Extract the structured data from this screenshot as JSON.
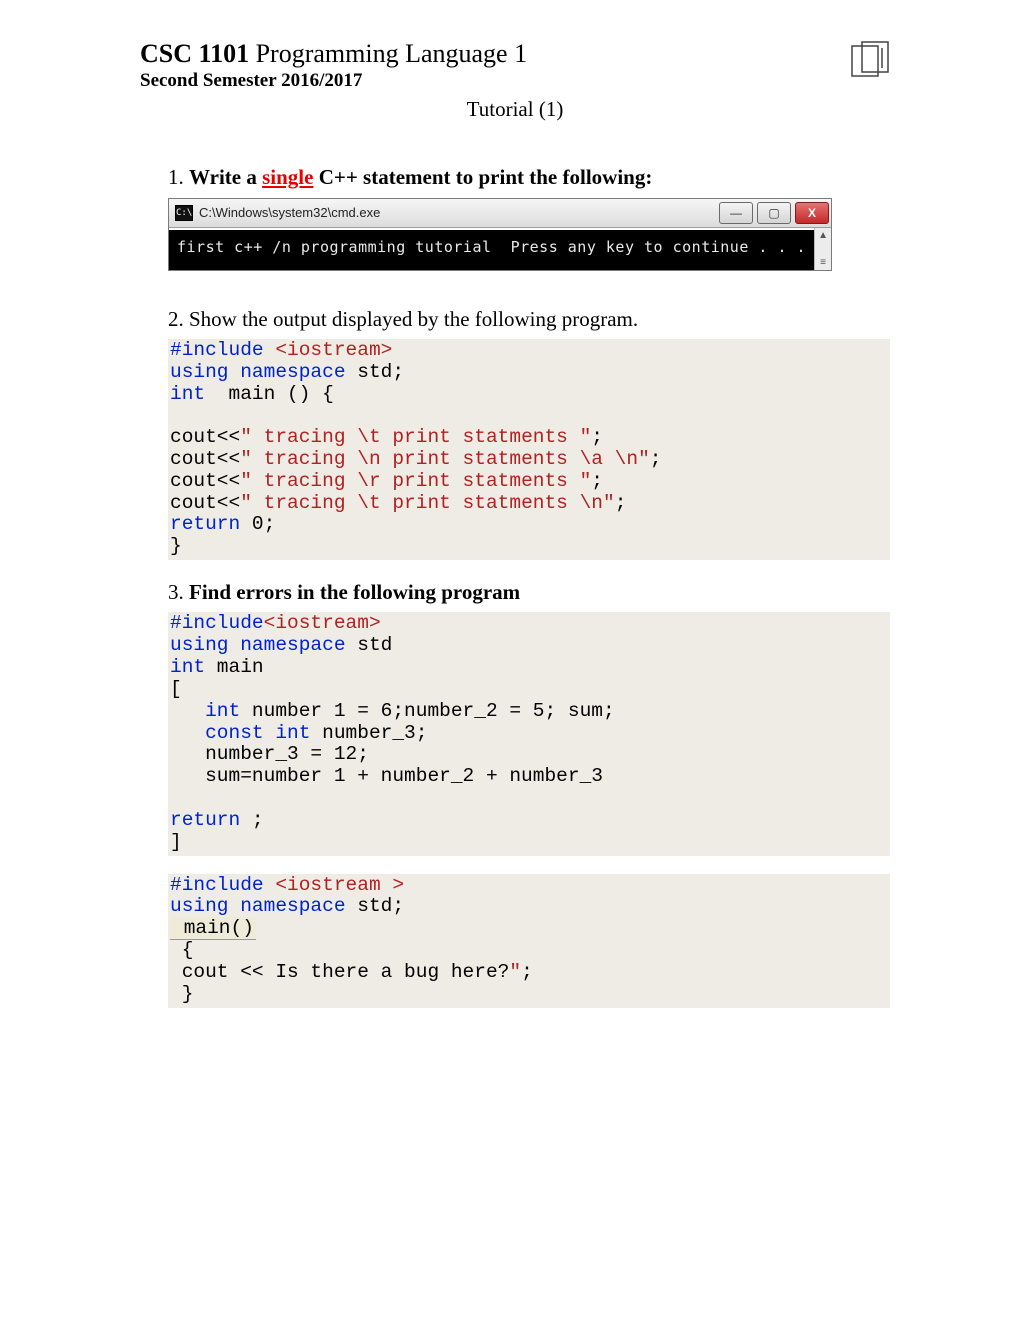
{
  "header": {
    "course_code": "CSC 1101",
    "course_title": " Programming Language 1",
    "semester": "Second Semester 2016/2017",
    "tutorial": "Tutorial (1)"
  },
  "q1": {
    "num": "1.",
    "pre_text": "Write a ",
    "single": "single",
    "post_text": " C++ statement to print the following:"
  },
  "cmd": {
    "icon_text": "C:\\",
    "title": "C:\\Windows\\system32\\cmd.exe",
    "min": "—",
    "max": "▢",
    "close": "X",
    "scroll_up": "▲",
    "scroll_down": "≡",
    "output": "first c++ /n programming tutorial  Press any key to continue . . ."
  },
  "q2": {
    "num": "2.",
    "text": "Show the output displayed by the following program.",
    "code": {
      "l1a": "#include ",
      "l1b": "<iostream>",
      "l2a": "using",
      "l2b": " namespace",
      "l2c": " std;",
      "l3a": "int",
      "l3b": "  main () {",
      "blank": "",
      "l5a": "cout<<",
      "l5b": "\" tracing \\t print statments \"",
      "l5c": ";",
      "l6a": "cout<<",
      "l6b": "\" tracing \\n print statments \\a \\n\"",
      "l6c": ";",
      "l7a": "cout<<",
      "l7b": "\" tracing \\r print statments \"",
      "l7c": ";",
      "l8a": "cout<<",
      "l8b": "\" tracing \\t print statments \\n\"",
      "l8c": ";",
      "l9a": "return",
      "l9b": " 0;",
      "l10": "}"
    }
  },
  "q3": {
    "num": "3.",
    "text": "Find errors in the following program",
    "codeA": {
      "l1a": "#include",
      "l1b": "<iostream>",
      "l2a": "using",
      "l2b": " namespace",
      "l2c": " std",
      "l3a": "int",
      "l3b": " main",
      "l4": "[",
      "l5a": "   int",
      "l5b": " number 1 = 6;number_2 = 5; sum;",
      "l6a": "   const",
      "l6b": " int",
      "l6c": " number_3;",
      "l7": "   number_3 = 12;",
      "l8": "   sum=number 1 + number_2 + number_3",
      "blank": "",
      "l10a": "return",
      "l10b": " ;",
      "l11": "]"
    },
    "codeB": {
      "l1a": "#include ",
      "l1b": "<iostream >",
      "l2a": "using",
      "l2b": " namespace",
      "l2c": " std;",
      "l3": " main()",
      "l4": " {",
      "l5a": " cout << Is there a bug here?",
      "l5b": "\"",
      "l5c": ";",
      "l6": " }"
    }
  }
}
